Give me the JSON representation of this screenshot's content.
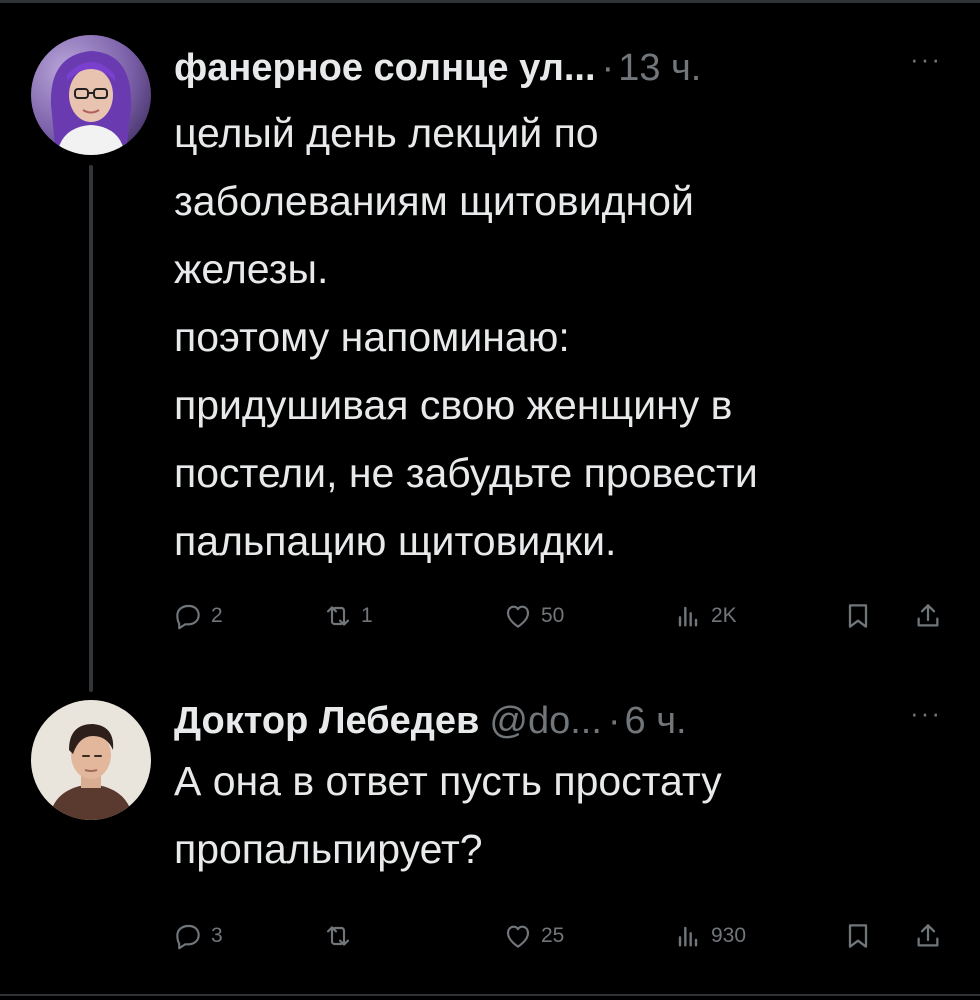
{
  "posts": [
    {
      "author_name": "фанерное солнце ул...",
      "separator": "·",
      "time": "13 ч.",
      "more": "···",
      "text_lines": [
        "целый день лекций по",
        "заболеваниям щитовидной",
        "железы.",
        "поэтому напоминаю:",
        "придушивая свою женщину в",
        "постели, не забудьте провести",
        "пальпацию щитовидки."
      ],
      "actions": {
        "reply_count": "2",
        "repost_count": "1",
        "like_count": "50",
        "view_count": "2K"
      },
      "avatar_icon": "avatar-woman-purple-hair"
    },
    {
      "author_name": "Доктор Лебедев",
      "handle": "@do...",
      "separator": "·",
      "time": "6 ч.",
      "more": "···",
      "text_lines": [
        "А она в ответ пусть простату",
        "пропальпирует?"
      ],
      "actions": {
        "reply_count": "3",
        "repost_count": "",
        "like_count": "25",
        "view_count": "930"
      },
      "avatar_icon": "avatar-man-dark-hair"
    }
  ],
  "colors": {
    "background": "#000000",
    "text_primary": "#e7e9ea",
    "text_secondary": "#71767b",
    "thread_line": "#333639"
  }
}
